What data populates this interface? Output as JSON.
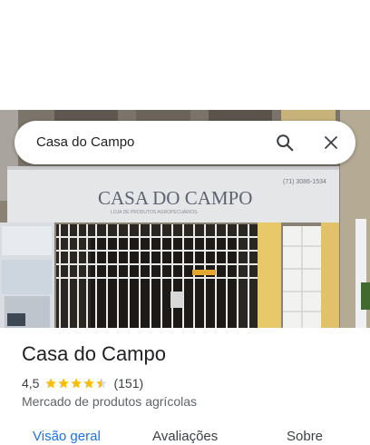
{
  "search": {
    "query": "Casa do Campo",
    "icon": "search-icon",
    "clear_icon": "close-icon"
  },
  "photo": {
    "sign_text": "CASA DO CAMPO",
    "phone_text": "(71) 3086-1534"
  },
  "place": {
    "name": "Casa do Campo",
    "rating": "4,5",
    "rating_value": 4.5,
    "review_count": "(151)",
    "category": "Mercado de produtos agrícolas"
  },
  "tabs": [
    {
      "label": "Visão geral",
      "active": true
    },
    {
      "label": "Avaliações",
      "active": false
    },
    {
      "label": "Sobre",
      "active": false
    }
  ],
  "colors": {
    "star": "#fbbc04",
    "accent": "#1a73e8"
  }
}
